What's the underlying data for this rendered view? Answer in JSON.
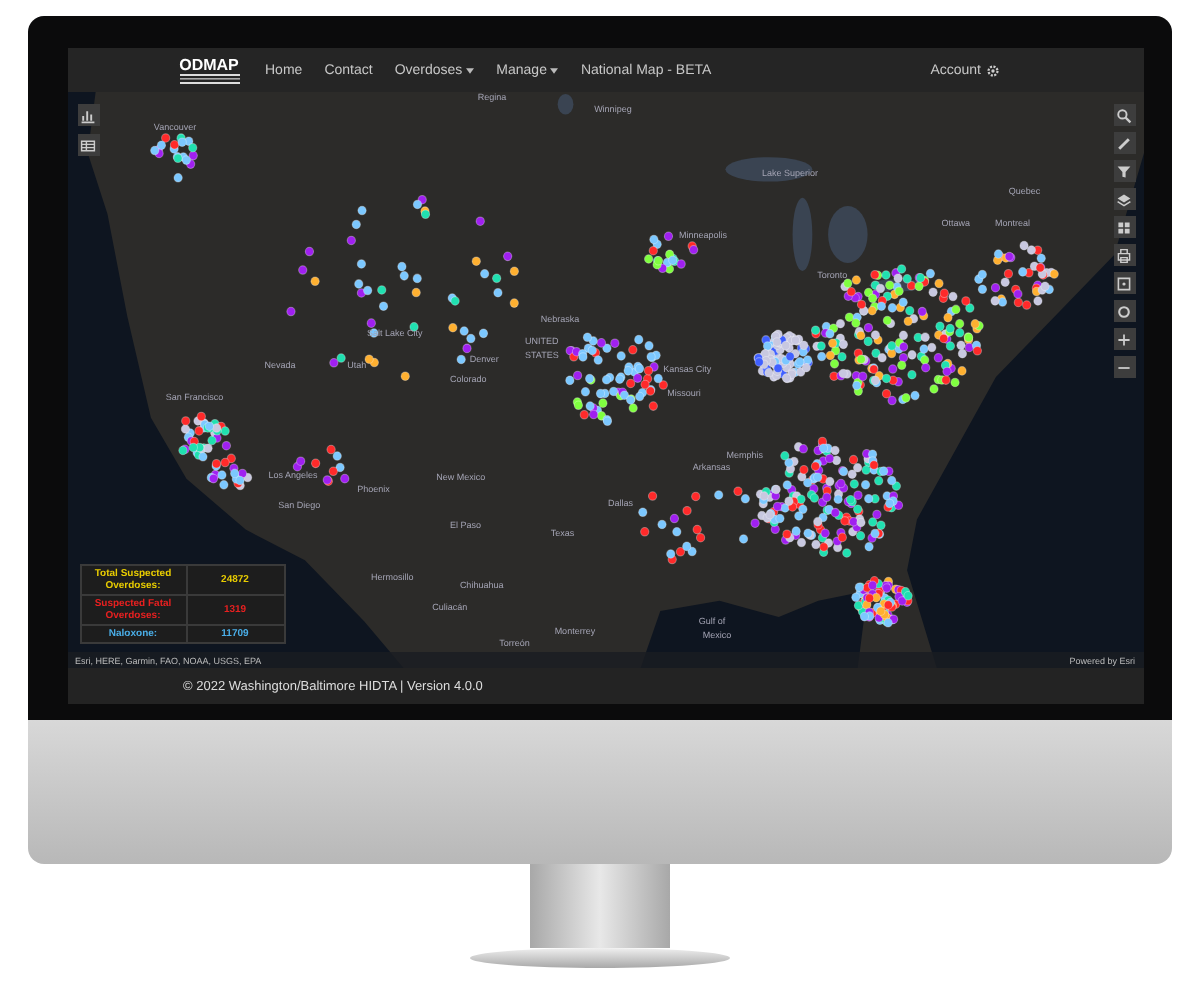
{
  "nav": {
    "logo": "ODMAP",
    "items": [
      {
        "label": "Home",
        "dropdown": false
      },
      {
        "label": "Contact",
        "dropdown": false
      },
      {
        "label": "Overdoses",
        "dropdown": true
      },
      {
        "label": "Manage",
        "dropdown": true
      },
      {
        "label": "National Map - BETA",
        "dropdown": false
      }
    ],
    "account": "Account"
  },
  "map": {
    "labels": [
      "Regina",
      "Winnipeg",
      "Vancouver",
      "Lake Superior",
      "Quebec",
      "Ottawa",
      "Montreal",
      "Minneapolis",
      "Toronto",
      "Nebraska",
      "Salt Lake City",
      "UNITED",
      "STATES",
      "Denver",
      "Nevada",
      "Utah",
      "Kansas City",
      "Colorado",
      "Missouri",
      "San Francisco",
      "Memphis",
      "Arkansas",
      "Los Angeles",
      "New Mexico",
      "Phoenix",
      "Dallas",
      "San Diego",
      "El Paso",
      "Texas",
      "Hermosillo",
      "Chihuahua",
      "Culiacán",
      "Gulf of",
      "Monterrey",
      "Mexico",
      "Torreón"
    ],
    "attribution": "Esri, HERE, Garmin, FAO, NOAA, USGS, EPA",
    "powered_by": "Powered by Esri"
  },
  "stats": [
    {
      "label": "Total Suspected Overdoses:",
      "value": "24872",
      "color": "#e8cc00"
    },
    {
      "label": "Suspected Fatal Overdoses:",
      "value": "1319",
      "color": "#e82020"
    },
    {
      "label": "Naloxone:",
      "value": "11709",
      "color": "#4aaee8"
    }
  ],
  "footer": "© 2022 Washington/Baltimore HIDTA | Version 4.0.0"
}
